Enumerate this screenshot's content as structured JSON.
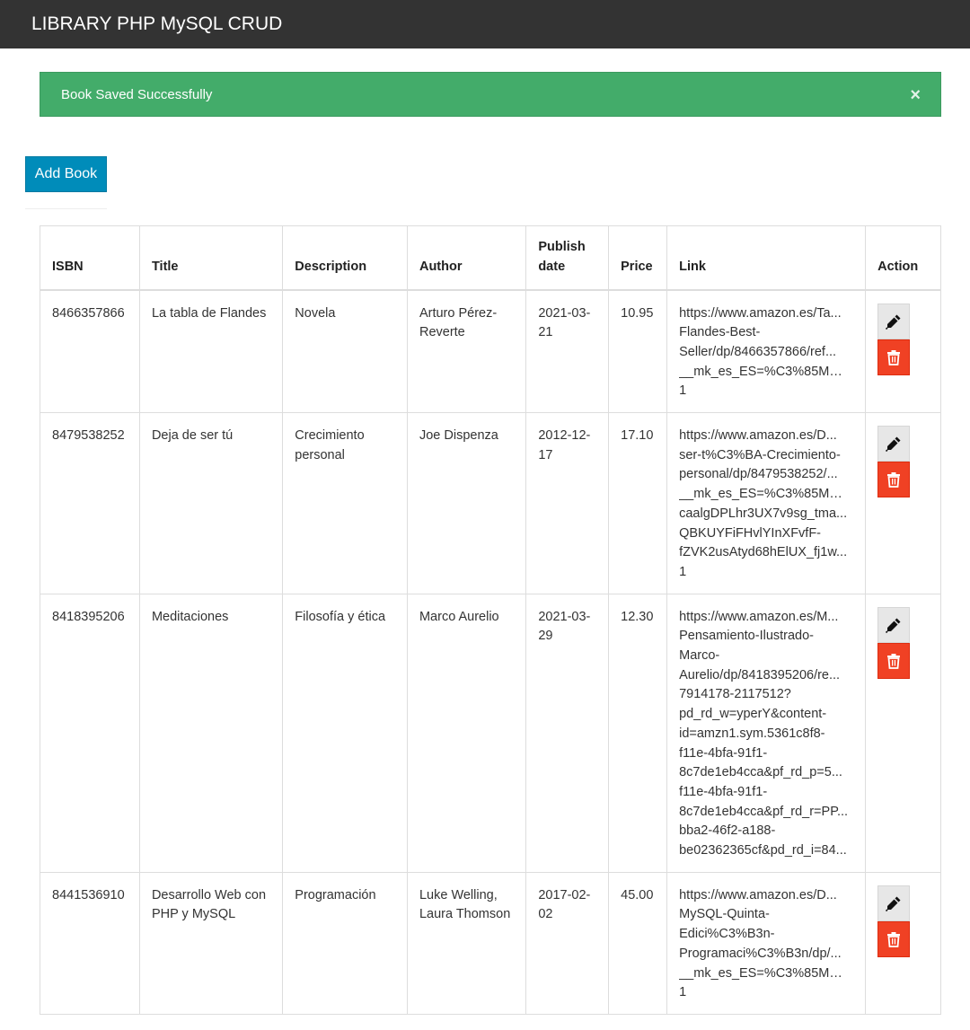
{
  "app": {
    "title": "LIBRARY PHP MySQL CRUD"
  },
  "alert": {
    "message": "Book Saved Successfully",
    "close_symbol": "×"
  },
  "toolbar": {
    "add_label": "Add Book"
  },
  "table": {
    "headers": {
      "isbn": "ISBN",
      "title": "Title",
      "description": "Description",
      "author": "Author",
      "publish_date_line1": "Publish",
      "publish_date_line2": "date",
      "price": "Price",
      "link": "Link",
      "action": "Action"
    },
    "rows": [
      {
        "isbn": "8466357866",
        "title": "La tabla de Flandes",
        "description": "Novela",
        "author": "Arturo Pérez-Reverte",
        "date_line1": "2021-03-",
        "date_line2": "21",
        "price": "10.95",
        "link_lines": [
          "https://www.amazon.es/Ta...",
          "Flandes-Best-",
          "Seller/dp/8466357866/ref...",
          "__mk_es_ES=%C3%85M%C...",
          "1"
        ]
      },
      {
        "isbn": "8479538252",
        "title": "Deja de ser tú",
        "description": "Crecimiento personal",
        "author": "Joe Dispenza",
        "date_line1": "2012-12-",
        "date_line2": "17",
        "price": "17.10",
        "link_lines": [
          "https://www.amazon.es/D...",
          "ser-t%C3%BA-Crecimiento-",
          "personal/dp/8479538252/...",
          "__mk_es_ES=%C3%85M%C...",
          "caalgDPLhr3UX7v9sg_tma...",
          "QBKUYFiFHvlYInXFvfF-",
          "fZVK2usAtyd68hElUX_fj1w...",
          "1"
        ]
      },
      {
        "isbn": "8418395206",
        "title": "Meditaciones",
        "description": "Filosofía y ética",
        "author": "Marco Aurelio",
        "date_line1": "2021-03-",
        "date_line2": "29",
        "price": "12.30",
        "link_lines": [
          "https://www.amazon.es/M...",
          "Pensamiento-Ilustrado-",
          "Marco-",
          "Aurelio/dp/8418395206/re...",
          "7914178-2117512?",
          "pd_rd_w=yperY&content-",
          "id=amzn1.sym.5361c8f8-",
          "f11e-4bfa-91f1-",
          "8c7de1eb4cca&pf_rd_p=5...",
          "f11e-4bfa-91f1-",
          "8c7de1eb4cca&pf_rd_r=PP...",
          "bba2-46f2-a188-",
          "be02362365cf&pd_rd_i=84..."
        ]
      },
      {
        "isbn": "8441536910",
        "title": "Desarrollo Web con PHP y MySQL",
        "description": "Programación",
        "author": "Luke Welling, Laura Thomson",
        "date_line1": "2017-02-",
        "date_line2": "02",
        "price": "45.00",
        "link_lines": [
          "https://www.amazon.es/D...",
          "MySQL-Quinta-",
          "Edici%C3%B3n-",
          "Programaci%C3%B3n/dp/...",
          "__mk_es_ES=%C3%85M%C...",
          "1"
        ]
      }
    ]
  },
  "icons": {
    "edit": "pencil-icon",
    "delete": "trash-icon"
  },
  "colors": {
    "navbar": "#333333",
    "alert_success": "#43ac6a",
    "primary_button": "#008cba",
    "delete_button": "#f04124",
    "edit_button": "#e7e7e7"
  }
}
